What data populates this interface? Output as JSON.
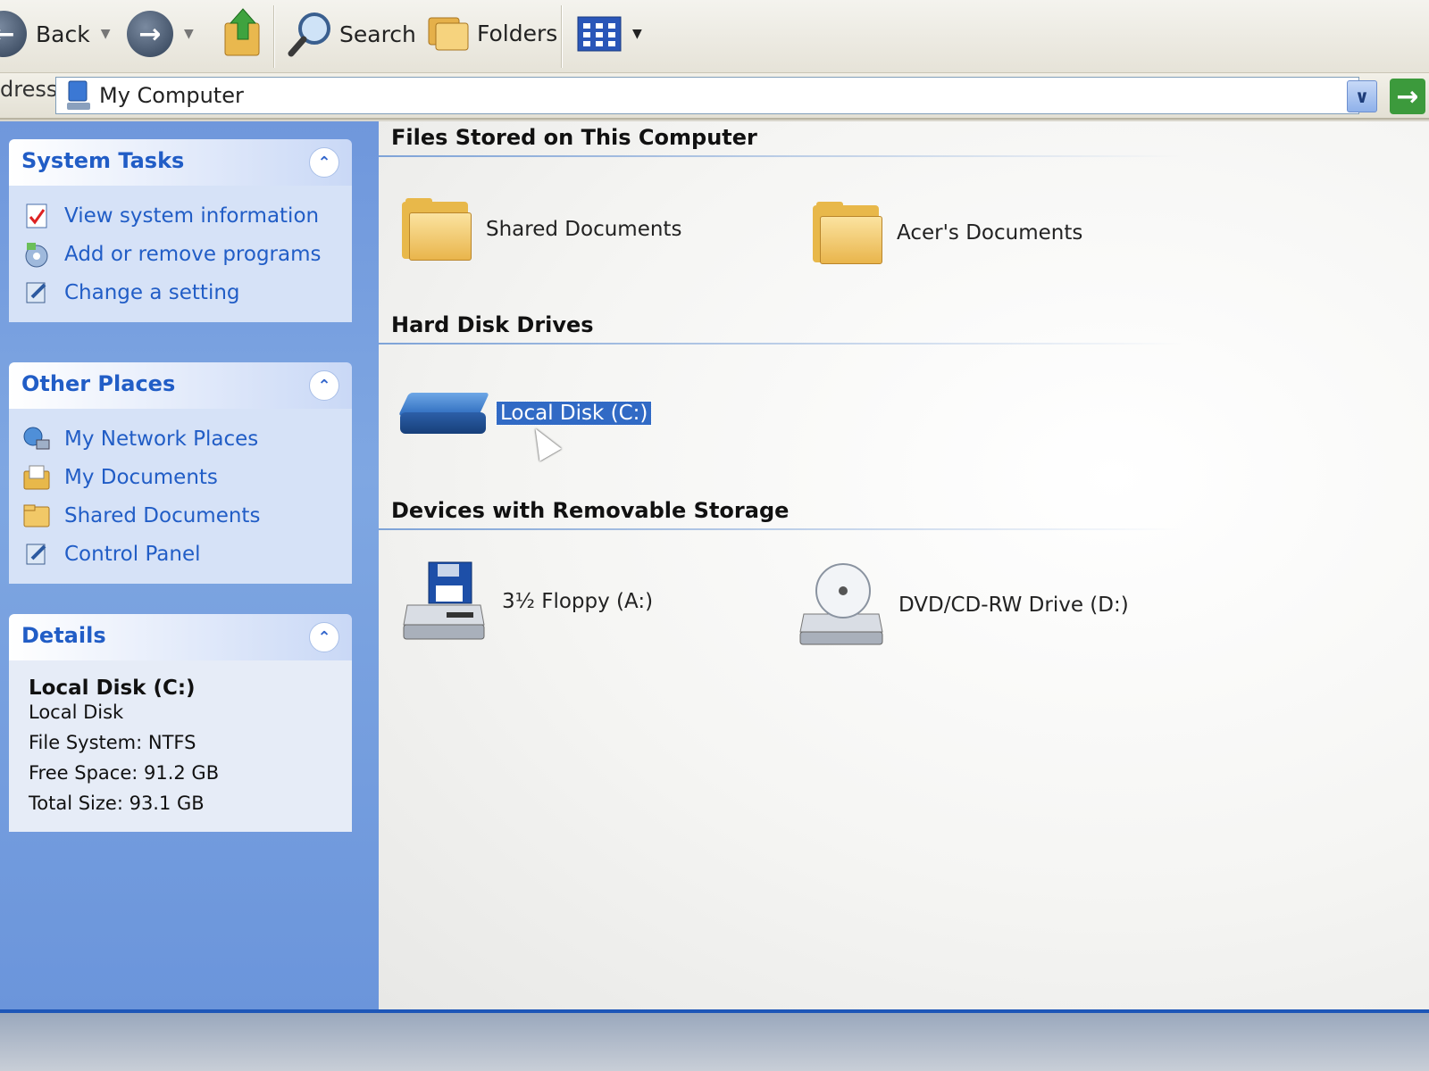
{
  "toolbar": {
    "back_label": "Back",
    "search_label": "Search",
    "folders_label": "Folders"
  },
  "address": {
    "label": "dress",
    "value": "My Computer"
  },
  "panels": {
    "system_tasks": {
      "title": "System Tasks",
      "items": [
        {
          "label": "View system information",
          "icon": "system-info-icon"
        },
        {
          "label": "Add or remove programs",
          "icon": "programs-icon"
        },
        {
          "label": "Change a setting",
          "icon": "control-panel-icon"
        }
      ]
    },
    "other_places": {
      "title": "Other Places",
      "items": [
        {
          "label": "My Network Places",
          "icon": "network-icon"
        },
        {
          "label": "My Documents",
          "icon": "documents-icon"
        },
        {
          "label": "Shared Documents",
          "icon": "folder-icon"
        },
        {
          "label": "Control Panel",
          "icon": "control-panel-icon"
        }
      ]
    },
    "details": {
      "title": "Details",
      "name": "Local Disk (C:)",
      "type": "Local Disk",
      "file_system": "File System: NTFS",
      "free_space": "Free Space: 91.2 GB",
      "total_size": "Total Size: 93.1 GB"
    }
  },
  "groups": {
    "files": {
      "heading": "Files Stored on This Computer",
      "items": [
        "Shared Documents",
        "Acer's Documents"
      ]
    },
    "hard_disks": {
      "heading": "Hard Disk Drives",
      "items": [
        "Local Disk (C:)"
      ]
    },
    "removable": {
      "heading": "Devices with Removable Storage",
      "items": [
        "3½ Floppy (A:)",
        "DVD/CD-RW Drive (D:)"
      ]
    }
  },
  "colors": {
    "task_link": "#215dc6",
    "selection": "#316ac5",
    "left_pane": "#7fa7e2"
  }
}
